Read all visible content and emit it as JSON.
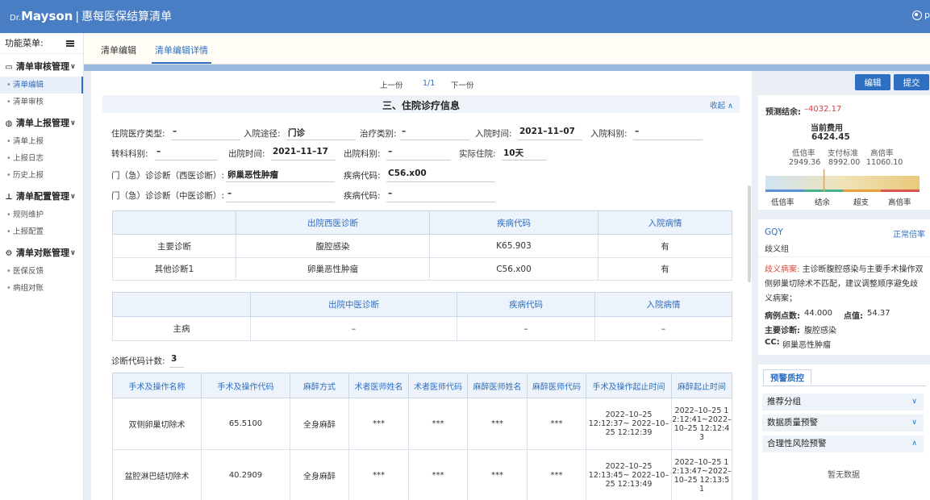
{
  "header": {
    "logo_dr": "Dr.",
    "logo_brand": "Mayson",
    "logo_sep": "|",
    "app_title": "惠每医保结算清单",
    "user_initial": "p"
  },
  "sidebar": {
    "title": "功能菜单:",
    "groups": [
      {
        "label": "清单审核管理",
        "icon": "monitor-icon",
        "items": [
          "清单编辑",
          "清单审核"
        ]
      },
      {
        "label": "清单上报管理",
        "icon": "globe-icon",
        "items": [
          "清单上报",
          "上报日志",
          "历史上报"
        ]
      },
      {
        "label": "清单配置管理",
        "icon": "org-chart-icon",
        "items": [
          "规则维护",
          "上报配置"
        ]
      },
      {
        "label": "清单对账管理",
        "icon": "gear-icon",
        "items": [
          "医保反馈",
          "病组对账"
        ]
      }
    ]
  },
  "tabs": [
    "清单编辑",
    "清单编辑详情"
  ],
  "pager": {
    "prev": "上一份",
    "page": "1/1",
    "next": "下一份"
  },
  "section": {
    "title": "三、住院诊疗信息",
    "collapse": "收起"
  },
  "fields": {
    "adm_type_label": "住院医疗类型:",
    "adm_type": "–",
    "adm_route_label": "入院途径:",
    "adm_route": "门诊",
    "treat_label": "治疗类别:",
    "treat": "–",
    "adm_time_label": "入院时间:",
    "adm_time": "2021–11–07",
    "adm_dept_label": "入院科别:",
    "adm_dept": "–",
    "trans_dept_label": "转科科别:",
    "trans_dept": "–",
    "dis_time_label": "出院时间:",
    "dis_time": "2021–11–17",
    "dis_dept_label": "出院科别:",
    "dis_dept": "–",
    "stay_label": "实际住院:",
    "stay": "10天",
    "opd_west_label": "门（急）诊诊断（西医诊断）:",
    "opd_west": "卵巢恶性肿瘤",
    "code1_label": "疾病代码:",
    "code1": "C56.x00",
    "opd_tcm_label": "门（急）诊诊断（中医诊断）:",
    "opd_tcm": "–",
    "code2_label": "疾病代码:",
    "code2": "–"
  },
  "west_table": {
    "headers": [
      "",
      "出院西医诊断",
      "疾病代码",
      "入院病情"
    ],
    "rows": [
      [
        "主要诊断",
        "腹腔感染",
        "K65.903",
        "有"
      ],
      [
        "其他诊断1",
        "卵巢恶性肿瘤",
        "C56.x00",
        "有"
      ]
    ]
  },
  "tcm_table": {
    "headers": [
      "",
      "出院中医诊断",
      "疾病代码",
      "入院病情"
    ],
    "rows": [
      [
        "主病",
        "–",
        "–",
        "–"
      ]
    ]
  },
  "diag_count_label": "诊断代码计数:",
  "diag_count": "3",
  "op_table": {
    "headers": [
      "手术及操作名称",
      "手术及操作代码",
      "麻醉方式",
      "术者医师姓名",
      "术者医师代码",
      "麻醉医师姓名",
      "麻醉医师代码",
      "手术及操作起止时间",
      "麻醉起止时间"
    ],
    "rows": [
      [
        "双侧卵巢切除术",
        "65.5100",
        "全身麻醉",
        "***",
        "***",
        "***",
        "***",
        "2022–10–25 12:12:37~ 2022–10–25 12:12:39",
        "2022–10–25 12:12:41~2022–10–25 12:12:43"
      ],
      [
        "盆腔淋巴结切除术",
        "40.2909",
        "全身麻醉",
        "***",
        "***",
        "***",
        "***",
        "2022–10–25 12:13:45~ 2022–10–25 12:13:49",
        "2022–10–25 12:13:47~2022–10–25 12:13:51"
      ]
    ]
  },
  "actions": {
    "edit": "编辑",
    "submit": "提交"
  },
  "forecast": {
    "label": "预测结余:",
    "value": "–4032.17",
    "cur_label": "当前费用",
    "cur_value": "6424.45",
    "low_label": "低倍率",
    "low_value": "2949.36",
    "std_label": "支付标准",
    "std_value": "8992.00",
    "high_label": "高倍率",
    "high_value": "11060.10",
    "scale": [
      "低倍率",
      "结余",
      "超支",
      "高倍率"
    ],
    "current_ratio": 0.38
  },
  "group_card": {
    "code": "GQY",
    "status": "正常倍率",
    "name": "歧义组",
    "ambiguity_label": "歧义病案:",
    "ambiguity_text": "主诊断腹腔感染与主要手术操作双侧卵巢切除术不匹配，建议调整顺序避免歧义病案；",
    "points_label": "病例点数:",
    "points": "44.000",
    "price_label": "点值:",
    "price": "54.37",
    "main_diag_label": "主要诊断:",
    "main_diag": "腹腔感染",
    "cc_label": "CC:",
    "cc": "卵巢恶性肿瘤"
  },
  "warning": {
    "tab": "预警质控",
    "rows": [
      "推荐分组",
      "数据质量预警",
      "合理性风险预警"
    ],
    "empty": "暂无数据"
  },
  "colors": {
    "primary": "#2f6fc1",
    "header": "#4a7ec4",
    "negative": "#e03b3b",
    "ambiguity": "#d94c3c"
  }
}
